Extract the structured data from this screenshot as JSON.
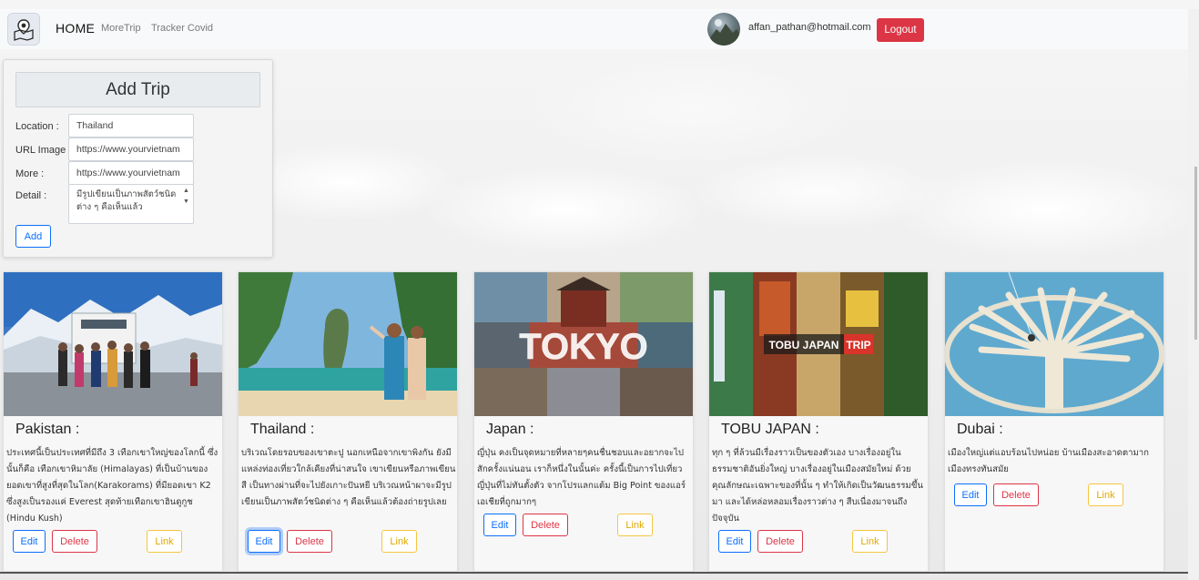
{
  "nav": {
    "home": "HOME",
    "more_trip": "MoreTrip",
    "tracker_covid": "Tracker Covid",
    "user_email": "affan_pathan@hotmail.com",
    "logout": "Logout"
  },
  "add_trip": {
    "title": "Add Trip",
    "location_label": "Location :",
    "location_value": "Thailand",
    "url_image_label": "URL Image :",
    "url_image_value": "https://www.yourvietnam",
    "more_label": "More :",
    "more_value": "https://www.yourvietnam",
    "detail_label": "Detail :",
    "detail_value": "มีรูปเขียนเป็นภาพสัตว์ชนิดต่าง ๆ คือเห็นแล้ว",
    "add_button": "Add"
  },
  "cards": [
    {
      "title": "Pakistan :",
      "text": "ประเทศนี้เป็นประเทศที่มีถึง 3 เทือกเขาใหญ่ของโลกนี้ ซึ่งนั้นก็คือ เทือกเขาหิมาลัย (Himalayas) ที่เป็นบ้านของยอดเขาที่สูงที่สุดในโลก(Karakorams) ที่มียอดเขา K2 ซึ่งสูงเป็นรองแค่ Everest สุดท้ายเทือกเขาฮินดูกูช (Hindu Kush)",
      "edit": "Edit",
      "delete": "Delete",
      "link": "Link"
    },
    {
      "title": "Thailand :",
      "text": "บริเวณโดยรอบของเขาตะปู นอกเหนือจากเขาพิงกัน ยังมีแหล่งท่องเที่ยวใกล้เคียงที่น่าสนใจ เขาเขียนหรือภาพเขียนสี เป็นทางผ่านที่จะไปยังเกาะปันหยี บริเวณหน้าผาจะมีรูปเขียนเป็นภาพสัตว์ชนิดต่าง ๆ คือเห็นแล้วต้องถ่ายรูปเลย",
      "edit": "Edit",
      "delete": "Delete",
      "link": "Link"
    },
    {
      "title": "Japan :",
      "text": "ญี่ปุ่น คงเป็นจุดหมายที่หลายๆคนชื่นชอบและอยากจะไปสักครั้งแน่นอน เราก็หนึ่งในนั้นค่ะ ครั้งนี้เป็นการไปเที่ยวญี่ปุ่นที่ไม่ทันตั้งตัว จากโปรแลกแต้ม Big Point ของแอร์เอเชียที่ถูกมากๆ",
      "edit": "Edit",
      "delete": "Delete",
      "link": "Link",
      "img_label": "TOKYO"
    },
    {
      "title": "TOBU JAPAN :",
      "text": "ทุก ๆ ที่ล้วนมีเรื่องราวเป็นของตัวเอง บางเรื่องอยู่ในธรรมชาติอันยิ่งใหญ่ บางเรื่องอยู่ในเมืองสมัยใหม่ ด้วยคุณลักษณะเฉพาะของที่นั้น ๆ ทำให้เกิดเป็นวัฒนธรรมขึ้นมา และได้หล่อหลอมเรื่องราวต่าง ๆ สืบเนื่องมาจนถึงปัจจุบัน",
      "edit": "Edit",
      "delete": "Delete",
      "link": "Link",
      "img_label_1": "TOBU JAPAN",
      "img_label_2": "TRIP"
    },
    {
      "title": "Dubai :",
      "text": "เมืองใหญ่แต่แอบร้อนไปหน่อย บ้านเมืองสะอาดตามาก เมืองทรงทันสมัย",
      "edit": "Edit",
      "delete": "Delete",
      "link": "Link"
    }
  ],
  "colors": {
    "primary": "#0d6efd",
    "danger": "#dc3545",
    "warning": "#f4c542",
    "navbar": "#f8f9fa"
  }
}
